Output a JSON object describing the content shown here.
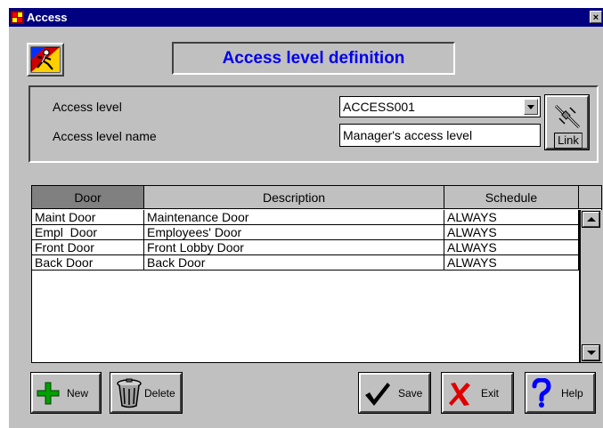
{
  "window": {
    "title": "Access",
    "close_label": "×"
  },
  "heading": "Access level definition",
  "form": {
    "access_level_label": "Access level",
    "access_level_value": "ACCESS001",
    "access_level_name_label": "Access level name",
    "access_level_name_value": "Manager's access level",
    "link_label": "Link"
  },
  "grid": {
    "columns": [
      "Door",
      "Description",
      "Schedule"
    ],
    "rows": [
      {
        "door": "Maint Door",
        "description": "Maintenance Door",
        "schedule": "ALWAYS"
      },
      {
        "door": "Empl  Door",
        "description": "Employees' Door",
        "schedule": "ALWAYS"
      },
      {
        "door": "Front Door",
        "description": "Front Lobby Door",
        "schedule": "ALWAYS"
      },
      {
        "door": "Back Door",
        "description": "Back Door",
        "schedule": "ALWAYS"
      }
    ]
  },
  "toolbar": {
    "new_label": "New",
    "delete_label": "Delete",
    "save_label": "Save",
    "exit_label": "Exit",
    "help_label": "Help"
  },
  "icons": {
    "app": "door-icon",
    "logo": "running-person-icon",
    "link": "cables-icon",
    "new": "plus-icon",
    "delete": "trash-can-icon",
    "save": "checkmark-icon",
    "exit": "x-icon",
    "help": "question-mark-icon"
  },
  "colors": {
    "title_bar": "#000080",
    "heading_text": "#0000ee",
    "window_bg": "#c0c0c0",
    "new_icon": "#00a000",
    "exit_icon": "#e00000",
    "help_icon": "#0000ff"
  }
}
